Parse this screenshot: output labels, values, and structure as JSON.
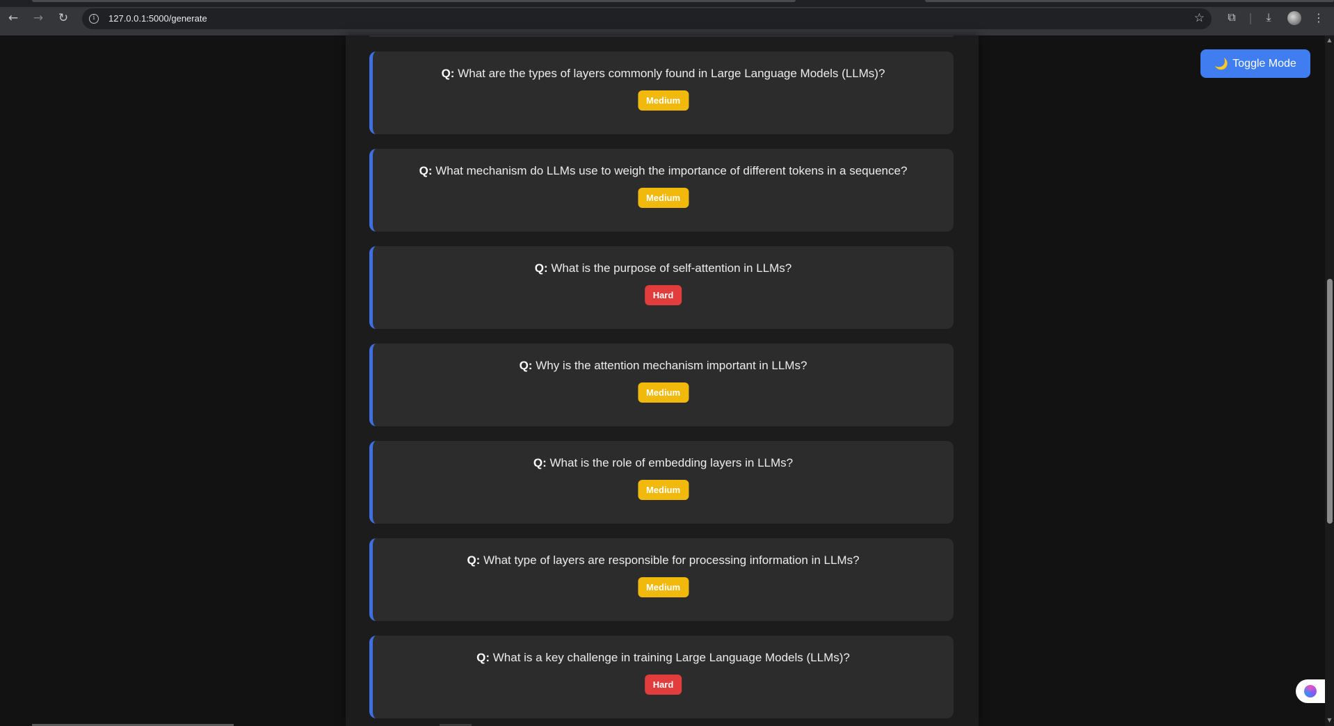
{
  "browser": {
    "url": "127.0.0.1:5000/generate",
    "icons": {
      "back": "arrow-left-icon",
      "forward": "arrow-right-icon",
      "reload": "reload-icon",
      "info": "info-icon",
      "bookmark": "star-icon",
      "extensions": "puzzle-icon",
      "downloads": "download-icon",
      "menu": "vertical-dots-icon"
    }
  },
  "toggle": {
    "label": "Toggle Mode",
    "icon": "🌙",
    "color": "#3f7df1"
  },
  "questions": [
    {
      "prefix": "Q:",
      "text": "What are the types of layers commonly found in Large Language Models (LLMs)?",
      "difficulty": "Medium"
    },
    {
      "prefix": "Q:",
      "text": "What mechanism do LLMs use to weigh the importance of different tokens in a sequence?",
      "difficulty": "Medium"
    },
    {
      "prefix": "Q:",
      "text": "What is the purpose of self-attention in LLMs?",
      "difficulty": "Hard"
    },
    {
      "prefix": "Q:",
      "text": "Why is the attention mechanism important in LLMs?",
      "difficulty": "Medium"
    },
    {
      "prefix": "Q:",
      "text": "What is the role of embedding layers in LLMs?",
      "difficulty": "Medium"
    },
    {
      "prefix": "Q:",
      "text": "What type of layers are responsible for processing information in LLMs?",
      "difficulty": "Medium"
    },
    {
      "prefix": "Q:",
      "text": "What is a key challenge in training Large Language Models (LLMs)?",
      "difficulty": "Hard"
    }
  ],
  "colors": {
    "card_accent": "#3f6fe0",
    "medium": "#f1b90c",
    "hard": "#e23d3d"
  }
}
